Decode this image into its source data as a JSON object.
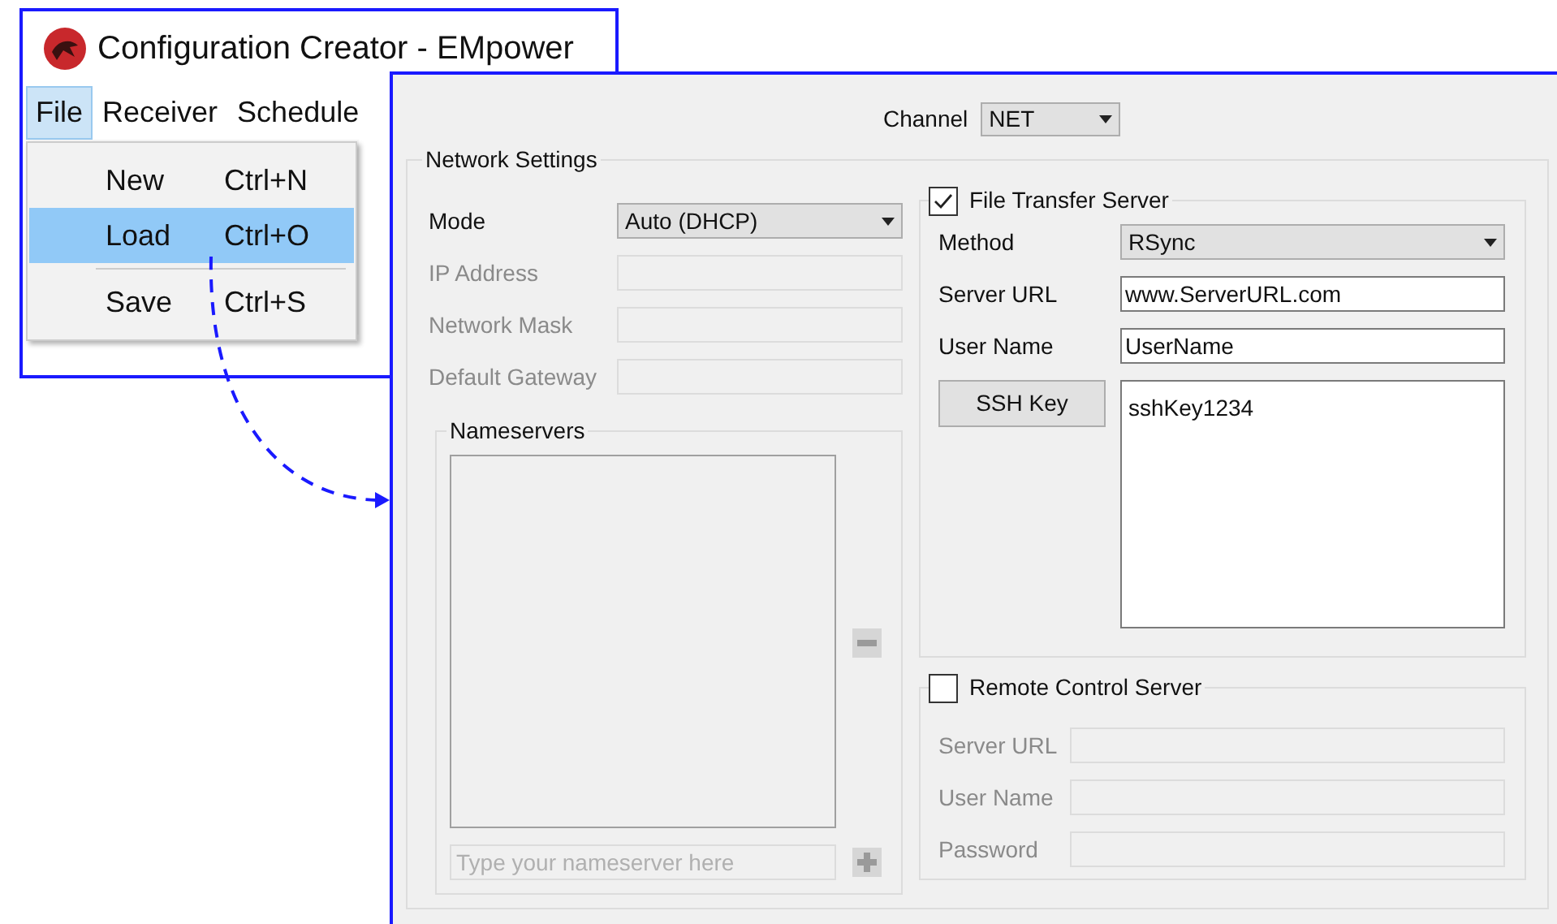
{
  "back_window": {
    "title": "Configuration Creator - EMpower",
    "menu": [
      {
        "label": "File",
        "selected": true
      },
      {
        "label": "Receiver",
        "selected": false
      },
      {
        "label": "Schedule",
        "selected": false
      }
    ],
    "dropdown": [
      {
        "kind": "item",
        "label": "New",
        "shortcut": "Ctrl+N",
        "selected": false
      },
      {
        "kind": "item",
        "label": "Load",
        "shortcut": "Ctrl+O",
        "selected": true
      },
      {
        "kind": "separator"
      },
      {
        "kind": "item",
        "label": "Save",
        "shortcut": "Ctrl+S",
        "selected": false
      }
    ]
  },
  "front_window": {
    "channel": {
      "label": "Channel",
      "value": "NET"
    },
    "network_settings": {
      "title": "Network Settings",
      "mode": {
        "label": "Mode",
        "value": "Auto (DHCP)"
      },
      "fields": [
        {
          "label": "IP Address",
          "disabled": true
        },
        {
          "label": "Network Mask",
          "disabled": true
        },
        {
          "label": "Default Gateway",
          "disabled": true
        }
      ],
      "nameservers": {
        "title": "Nameservers",
        "placeholder": "Type your nameserver here"
      }
    },
    "file_transfer_server": {
      "label": "File Transfer Server",
      "checked": true,
      "method": {
        "label": "Method",
        "value": "RSync"
      },
      "fields": [
        {
          "label": "Server URL",
          "value": "www.ServerURL.com"
        },
        {
          "label": "User Name",
          "value": "UserName"
        }
      ],
      "ssh_key": {
        "button": "SSH Key",
        "value": "sshKey1234"
      }
    },
    "remote_control_server": {
      "label": "Remote Control Server",
      "checked": false,
      "fields": [
        {
          "label": "Server URL"
        },
        {
          "label": "User Name"
        },
        {
          "label": "Password"
        }
      ]
    }
  }
}
